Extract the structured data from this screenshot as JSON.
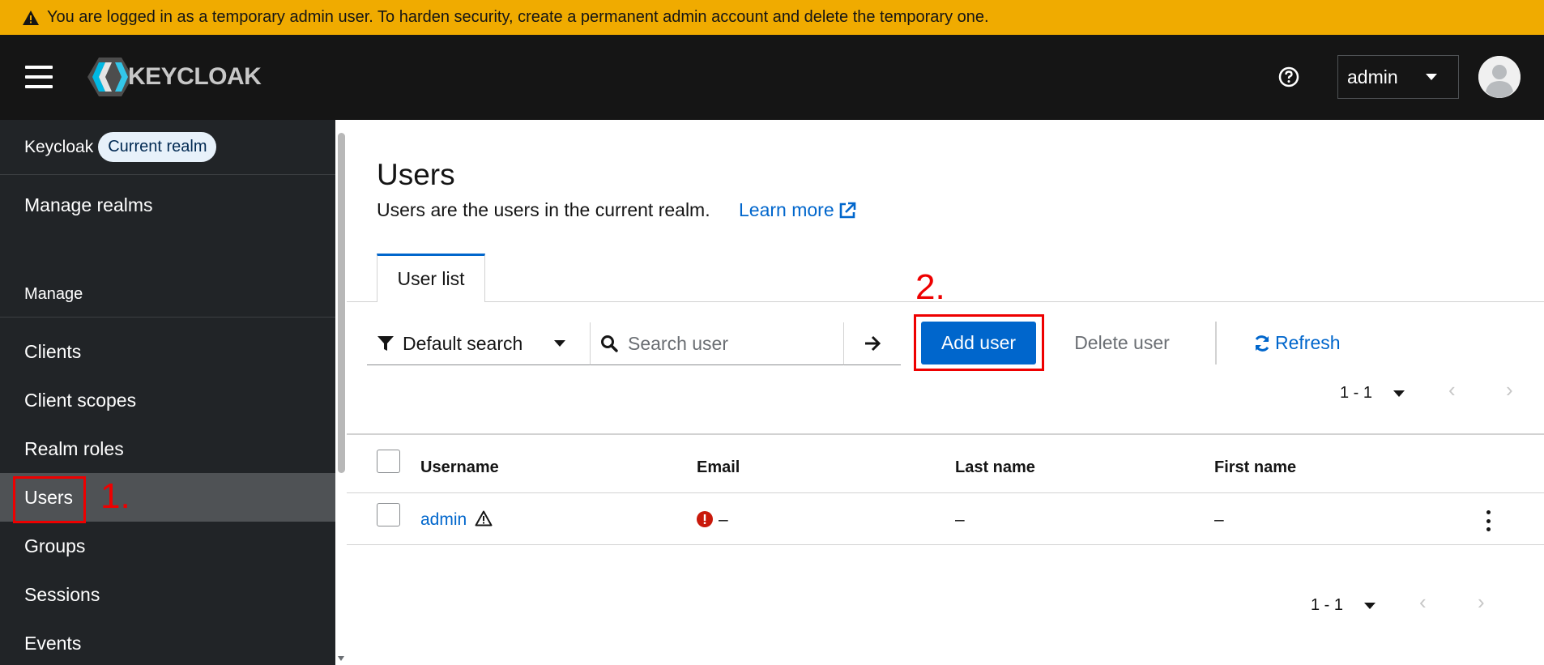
{
  "banner": {
    "text": "You are logged in as a temporary admin user. To harden security, create a permanent admin account and delete the temporary one."
  },
  "header": {
    "logo_text": "KEYCLOAK",
    "user_menu_label": "admin"
  },
  "sidebar": {
    "realm_name": "Keycloak",
    "realm_badge": "Current realm",
    "manage_realms": "Manage realms",
    "section_title": "Manage",
    "items": [
      {
        "label": "Clients"
      },
      {
        "label": "Client scopes"
      },
      {
        "label": "Realm roles"
      },
      {
        "label": "Users",
        "active": true
      },
      {
        "label": "Groups"
      },
      {
        "label": "Sessions"
      },
      {
        "label": "Events"
      }
    ]
  },
  "main": {
    "title": "Users",
    "description": "Users are the users in the current realm.",
    "learn_more": "Learn more",
    "tabs": [
      {
        "label": "User list",
        "active": true
      }
    ],
    "toolbar": {
      "filter_label": "Default search",
      "search_placeholder": "Search user",
      "add_user": "Add user",
      "delete_user": "Delete user",
      "refresh": "Refresh"
    },
    "pagination_top": {
      "range": "1 - 1"
    },
    "pagination_bottom": {
      "range": "1 - 1"
    },
    "table": {
      "columns": [
        "Username",
        "Email",
        "Last name",
        "First name"
      ],
      "rows": [
        {
          "username": "admin",
          "email": "–",
          "last_name": "–",
          "first_name": "–"
        }
      ]
    }
  },
  "annotations": {
    "step1": "1.",
    "step2": "2.",
    "color": "#ee0000"
  },
  "colors": {
    "banner": "#f0ab00",
    "masthead": "#151515",
    "sidebar": "#212427",
    "sidebar_active": "#4f5255",
    "primary": "#0066cc"
  }
}
